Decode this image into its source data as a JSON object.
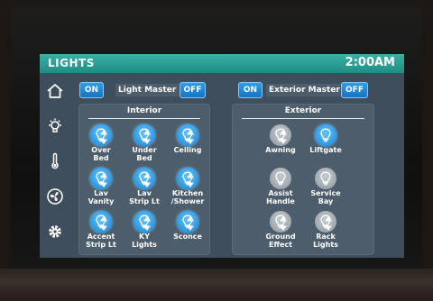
{
  "header": {
    "title": "LIGHTS",
    "time": "2:00AM"
  },
  "nav": [
    {
      "icon": "home-icon"
    },
    {
      "icon": "light-bulb-icon"
    },
    {
      "icon": "thermometer-icon"
    },
    {
      "icon": "fan-icon"
    },
    {
      "icon": "settings-gear-icon"
    }
  ],
  "master": {
    "light_master": {
      "label": "Light Master",
      "on": "ON",
      "off": "OFF"
    },
    "exterior_master": {
      "label": "Exterior Master",
      "on": "ON",
      "off": "OFF"
    }
  },
  "interior": {
    "title": "Interior",
    "lights": [
      {
        "label": [
          "Over",
          "Bed"
        ],
        "state": "on",
        "dimmable": true
      },
      {
        "label": [
          "Under",
          "Bed"
        ],
        "state": "on",
        "dimmable": true
      },
      {
        "label": [
          "Ceiling",
          ""
        ],
        "state": "on",
        "dimmable": true
      },
      {
        "label": [
          "Lav",
          "Vanity"
        ],
        "state": "on",
        "dimmable": true
      },
      {
        "label": [
          "Lav",
          "Strip Lt"
        ],
        "state": "on",
        "dimmable": true
      },
      {
        "label": [
          "Kitchen",
          "/Shower"
        ],
        "state": "on",
        "dimmable": true
      },
      {
        "label": [
          "Accent",
          "Strip Lt"
        ],
        "state": "on",
        "dimmable": true
      },
      {
        "label": [
          "KY",
          "Lights"
        ],
        "state": "on",
        "dimmable": true
      },
      {
        "label": [
          "Sconce",
          ""
        ],
        "state": "on",
        "dimmable": true
      }
    ]
  },
  "exterior": {
    "title": "Exterior",
    "lights": [
      {
        "label": [
          "Awning",
          ""
        ],
        "state": "off",
        "dimmable": true
      },
      {
        "label": [
          "Liftgate",
          ""
        ],
        "state": "on",
        "dimmable": false
      },
      {
        "label": [
          "Assist",
          "Handle"
        ],
        "state": "off",
        "dimmable": false
      },
      {
        "label": [
          "Service",
          "Bay"
        ],
        "state": "off",
        "dimmable": false
      },
      {
        "label": [
          "Ground",
          "Effect"
        ],
        "state": "off",
        "dimmable": true
      },
      {
        "label": [
          "Rack",
          "Lights"
        ],
        "state": "off",
        "dimmable": true
      }
    ]
  },
  "colors": {
    "accent_bar": "#2aa396",
    "button_blue": "#1f8be0",
    "bulb_on": "#2a9ff0",
    "bulb_off": "#a9b2ba",
    "panel_bg": "#4d5d6c"
  }
}
